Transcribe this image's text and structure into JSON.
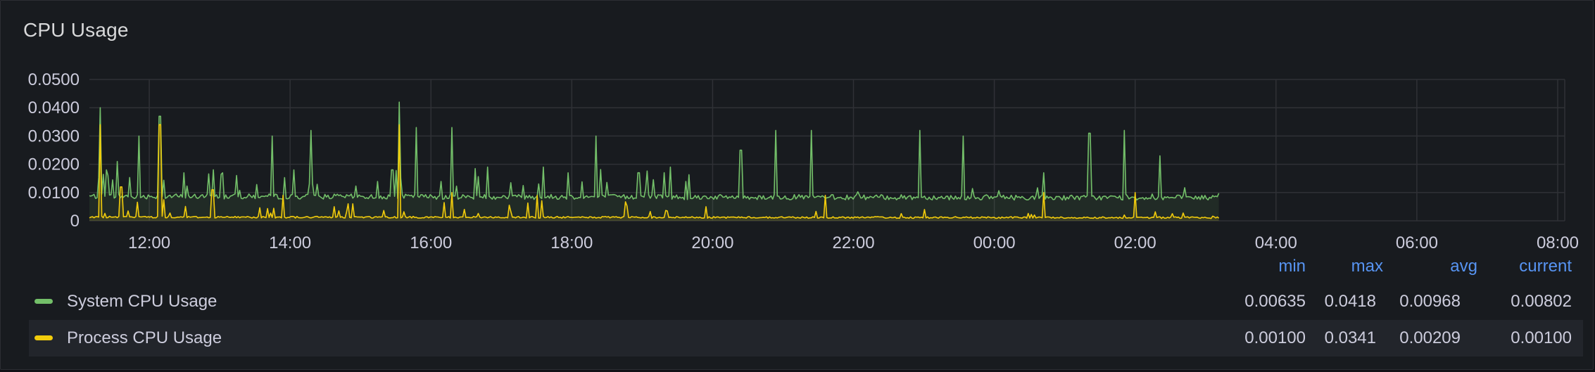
{
  "panel": {
    "title": "CPU Usage"
  },
  "legend": {
    "columns": [
      "min",
      "max",
      "avg",
      "current"
    ],
    "rows": [
      {
        "name": "System CPU Usage",
        "color": "#73bf69",
        "min": "0.00635",
        "max": "0.0418",
        "avg": "0.00968",
        "current": "0.00802"
      },
      {
        "name": "Process CPU Usage",
        "color": "#f2cc0c",
        "min": "0.00100",
        "max": "0.0341",
        "avg": "0.00209",
        "current": "0.00100"
      }
    ]
  },
  "chart_data": {
    "type": "line",
    "title": "CPU Usage",
    "xlabel": "",
    "ylabel": "",
    "y_ticks": [
      "0",
      "0.0100",
      "0.0200",
      "0.0300",
      "0.0400",
      "0.0500"
    ],
    "y_tick_values": [
      0,
      0.01,
      0.02,
      0.03,
      0.04,
      0.05
    ],
    "ylim": [
      0,
      0.05
    ],
    "x_ticks": [
      "12:00",
      "14:00",
      "16:00",
      "18:00",
      "20:00",
      "22:00",
      "00:00",
      "02:00",
      "04:00",
      "06:00",
      "08:00"
    ],
    "x_tick_hours": [
      12,
      14,
      16,
      18,
      20,
      22,
      24,
      26,
      28,
      30,
      32
    ],
    "xlim_hours": [
      11.15,
      32.1
    ],
    "grid": true,
    "legend_placement": "bottom",
    "series": [
      {
        "name": "System CPU Usage",
        "color": "#73bf69",
        "baseline": 0.0085,
        "baseline_end": 0.008,
        "spikes": [
          [
            11.3,
            0.04
          ],
          [
            11.55,
            0.021
          ],
          [
            11.85,
            0.03
          ],
          [
            12.15,
            0.037
          ],
          [
            12.5,
            0.017
          ],
          [
            13.05,
            0.017
          ],
          [
            13.75,
            0.03
          ],
          [
            14.05,
            0.018
          ],
          [
            14.3,
            0.032
          ],
          [
            15.45,
            0.018
          ],
          [
            15.55,
            0.042
          ],
          [
            15.8,
            0.033
          ],
          [
            16.3,
            0.033
          ],
          [
            16.8,
            0.019
          ],
          [
            17.6,
            0.019
          ],
          [
            17.95,
            0.017
          ],
          [
            18.35,
            0.03
          ],
          [
            18.95,
            0.017
          ],
          [
            19.4,
            0.019
          ],
          [
            20.4,
            0.025
          ],
          [
            20.9,
            0.032
          ],
          [
            21.4,
            0.032
          ],
          [
            22.95,
            0.032
          ],
          [
            23.55,
            0.03
          ],
          [
            25.35,
            0.031
          ],
          [
            25.85,
            0.032
          ],
          [
            26.35,
            0.023
          ],
          [
            24.7,
            0.017
          ]
        ]
      },
      {
        "name": "Process CPU Usage",
        "color": "#f2cc0c",
        "baseline": 0.0012,
        "baseline_end": 0.001,
        "spikes": [
          [
            11.3,
            0.034
          ],
          [
            12.15,
            0.034
          ],
          [
            11.6,
            0.012
          ],
          [
            12.9,
            0.011
          ],
          [
            15.55,
            0.034
          ],
          [
            16.3,
            0.01
          ],
          [
            13.9,
            0.009
          ],
          [
            17.5,
            0.009
          ],
          [
            21.6,
            0.009
          ],
          [
            24.7,
            0.01
          ],
          [
            26.0,
            0.01
          ],
          [
            19.9,
            0.005
          ],
          [
            23.0,
            0.004
          ]
        ]
      }
    ],
    "data_end_hour": 27.2
  }
}
